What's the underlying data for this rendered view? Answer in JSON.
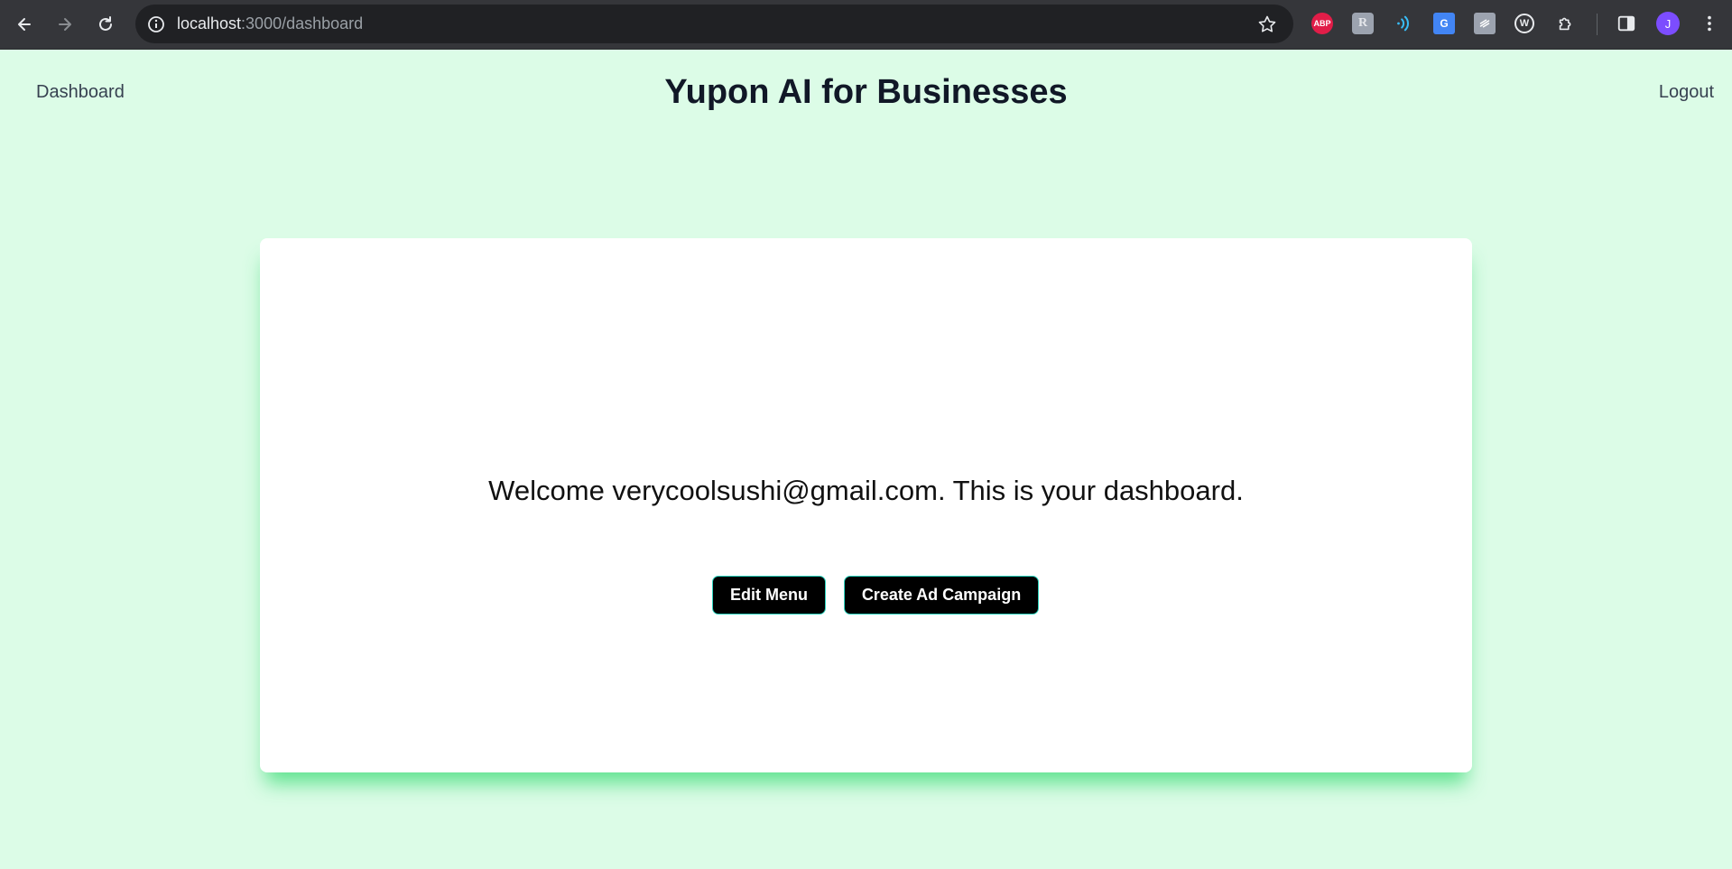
{
  "browser": {
    "url_host": "localhost",
    "url_rest": ":3000/dashboard",
    "profile_initial": "J",
    "extensions": [
      "ABP",
      "R",
      "wave",
      "G",
      "S",
      "W"
    ]
  },
  "header": {
    "left_link": "Dashboard",
    "title": "Yupon AI for Businesses",
    "right_link": "Logout"
  },
  "main": {
    "welcome": "Welcome verycoolsushi@gmail.com. This is your dashboard.",
    "buttons": {
      "edit_menu": "Edit Menu",
      "create_campaign": "Create Ad Campaign"
    }
  },
  "colors": {
    "page_background": "#dcfce7",
    "card_background": "#ffffff",
    "card_shadow": "#4ade80",
    "button_background": "#000000",
    "button_border": "#2dd4bf",
    "avatar": "#7c4dff"
  }
}
